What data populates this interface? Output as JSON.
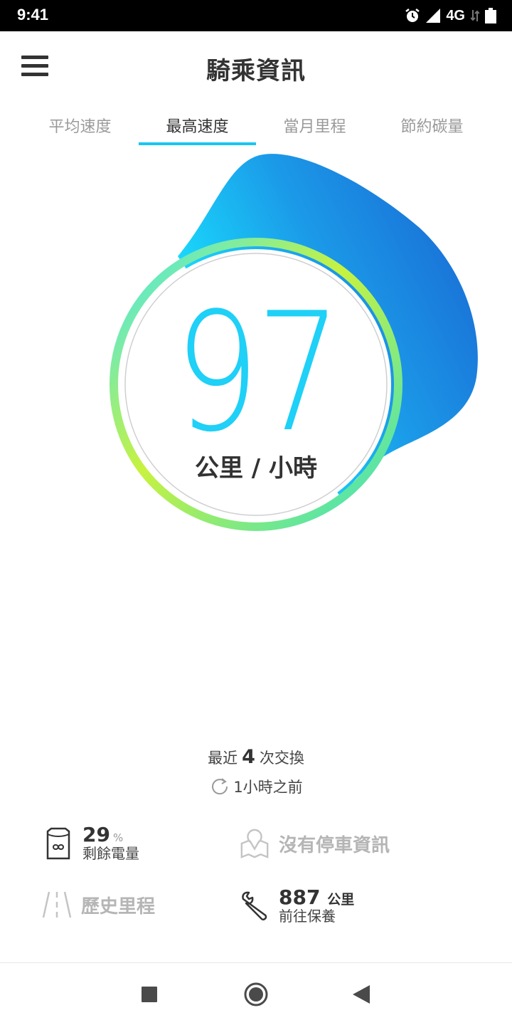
{
  "status": {
    "time": "9:41",
    "network": "4G"
  },
  "header": {
    "title": "騎乘資訊",
    "menu_icon": "hamburger-menu-icon"
  },
  "tabs": [
    {
      "label": "平均速度",
      "active": false
    },
    {
      "label": "最高速度",
      "active": true
    },
    {
      "label": "當月里程",
      "active": false
    },
    {
      "label": "節約碳量",
      "active": false
    }
  ],
  "gauge": {
    "value": "97",
    "unit": "公里 / 小時",
    "colors": {
      "blue_dark": "#1a73d9",
      "cyan": "#1fd0f7",
      "lime": "#d6f53c"
    }
  },
  "swap": {
    "prefix": "最近",
    "count": "4",
    "suffix": "次交換",
    "time_ago": "1小時之前"
  },
  "battery": {
    "value": "29",
    "unit": "%",
    "label": "剩餘電量"
  },
  "parking": {
    "label": "沒有停車資訊"
  },
  "history": {
    "label": "歷史里程"
  },
  "maintenance": {
    "value": "887",
    "unit": "公里",
    "label": "前往保養"
  },
  "nav": {
    "recents": "recents-square-icon",
    "home": "home-circle-icon",
    "back": "back-triangle-icon"
  }
}
